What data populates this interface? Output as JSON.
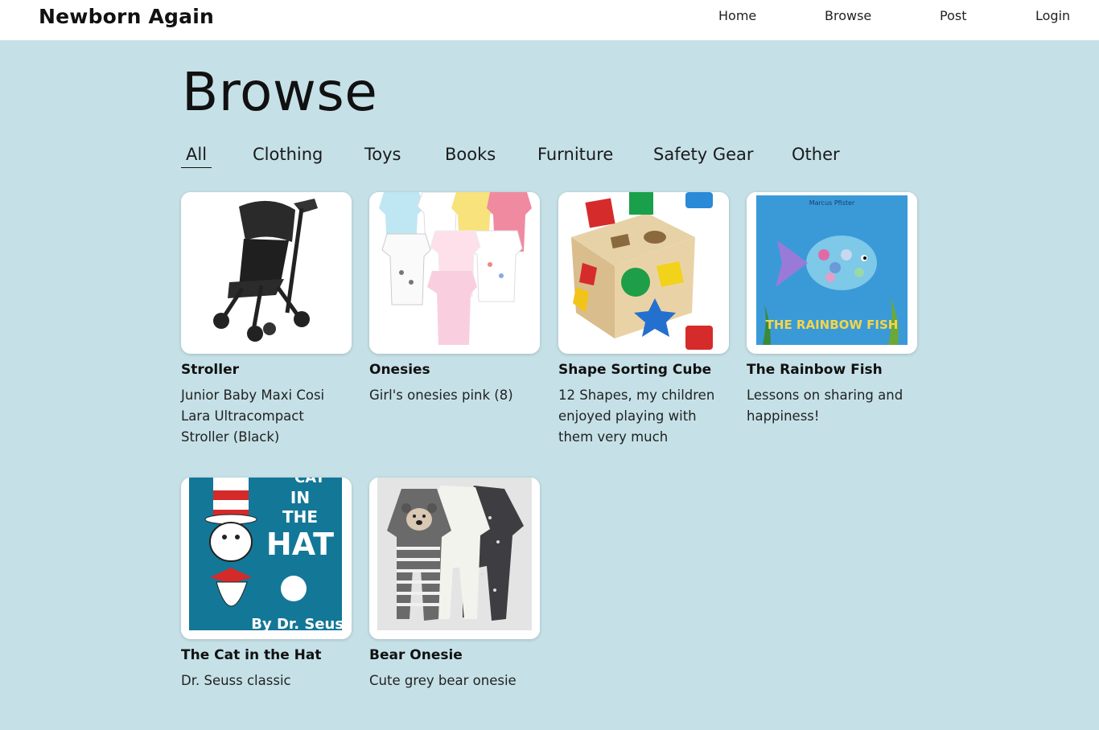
{
  "header": {
    "brand": "Newborn Again",
    "nav": [
      "Home",
      "Browse",
      "Post",
      "Login"
    ]
  },
  "page": {
    "title": "Browse"
  },
  "tabs": [
    "All",
    "Clothing",
    "Toys",
    "Books",
    "Furniture",
    "Safety Gear",
    "Other"
  ],
  "active_tab": "All",
  "items": [
    {
      "title": "Stroller",
      "desc": "Junior Baby Maxi Cosi Lara Ultracompact Stroller (Black)",
      "image": "stroller-image"
    },
    {
      "title": "Onesies",
      "desc": "Girl's onesies pink (8)",
      "image": "onesies-image"
    },
    {
      "title": "Shape Sorting Cube",
      "desc": "12 Shapes, my children enjoyed playing with them very much",
      "image": "shape-cube-image"
    },
    {
      "title": "The Rainbow Fish",
      "desc": "Lessons on sharing and happiness!",
      "image": "rainbow-fish-cover",
      "cover_text": "THE RAINBOW FISH",
      "cover_author": "Marcus Pfister"
    },
    {
      "title": "The Cat in the Hat",
      "desc": "Dr. Seuss classic",
      "image": "cat-in-hat-cover",
      "cover_text": [
        "CAT",
        "IN",
        "THE",
        "HAT",
        "By Dr. Seuss"
      ]
    },
    {
      "title": "Bear Onesie",
      "desc": "Cute grey bear onesie",
      "image": "bear-onesie-image"
    }
  ],
  "colors": {
    "background": "#c5e1e7",
    "header": "#ffffff",
    "card": "#ffffff"
  }
}
